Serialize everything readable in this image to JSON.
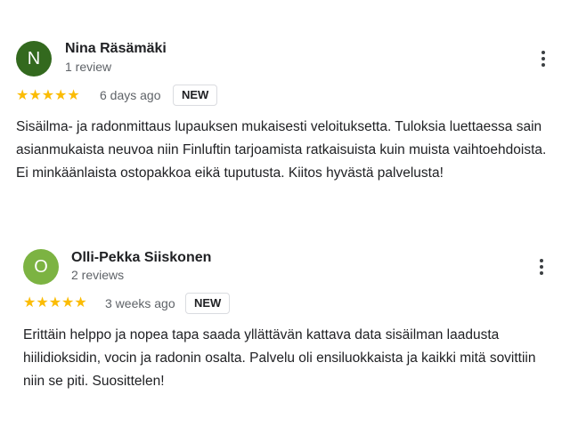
{
  "reviews": [
    {
      "avatar_letter": "N",
      "avatar_color": "#33691e",
      "name": "Nina Räsämäki",
      "review_count": "1 review",
      "stars": "★★★★★",
      "rating": 5,
      "date": "6 days ago",
      "badge": "NEW",
      "text": "Sisäilma- ja radonmittaus lupauksen mukaisesti veloituksetta. Tuloksia luettaessa sain asianmukaista neuvoa niin Finluftin tarjoamista ratkaisuista kuin muista vaihtoehdoista. Ei minkäänlaista ostopakkoa eikä tuputusta. Kiitos hyvästä palvelusta!",
      "menu_icon": "more-vert-icon"
    },
    {
      "avatar_letter": "O",
      "avatar_color": "#7cb342",
      "name": "Olli-Pekka Siiskonen",
      "review_count": "2 reviews",
      "stars": "★★★★★",
      "rating": 5,
      "date": "3 weeks ago",
      "badge": "NEW",
      "text": "Erittäin helppo ja nopea tapa saada yllättävän kattava data sisäilman laadusta hiilidioksidin, vocin ja radonin osalta. Palvelu oli ensiluokkaista ja kaikki mitä sovittiin niin se piti. Suosittelen!",
      "menu_icon": "more-vert-icon"
    }
  ],
  "colors": {
    "star": "#fbbc04",
    "secondary_text": "#5f6368",
    "primary_text": "#202124"
  }
}
